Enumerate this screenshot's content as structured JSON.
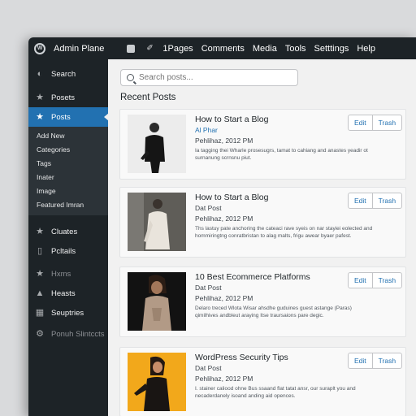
{
  "topbar": {
    "site_name": "Admin Plane",
    "menu": [
      "1Pages",
      "Comments",
      "Media",
      "Tools",
      "Setttings",
      "Help"
    ]
  },
  "sidebar": {
    "items_top": [
      {
        "label": "Search",
        "icon": "palette-icon"
      },
      {
        "label": "Posets",
        "icon": "pin-icon"
      },
      {
        "label": "Posts",
        "icon": "pin-icon",
        "active": true
      }
    ],
    "submenu": [
      "Add New",
      "Categories",
      "Tags",
      "Inater",
      "Image",
      "Featured Imran"
    ],
    "items_bottom": [
      {
        "label": "Cluates",
        "icon": "pin-icon"
      },
      {
        "label": "Pcltails",
        "icon": "page-icon"
      },
      {
        "label": "Hxms",
        "icon": "people-icon"
      },
      {
        "label": "Heasts",
        "icon": "person-icon"
      },
      {
        "label": "Seuptries",
        "icon": "grid-icon"
      },
      {
        "label": "Ponuh Slintccts",
        "icon": "gear-icon"
      }
    ]
  },
  "main": {
    "search_placeholder": "Search posts...",
    "section_title": "Recent Posts",
    "posts": [
      {
        "title": "How to Start a Blog",
        "meta": "Al Phar",
        "date": "Pehlihaz, 2012 PM",
        "excerpt": "Ia tagging thei Wharle prosesugrs, tamat to cahiang and anastes yeadir ot surnanung scrnsnu piut.",
        "edit": "Edit",
        "trash": "Trash"
      },
      {
        "title": "How to Start a Blog",
        "meta": "Dat Post",
        "date": "Pehlihaz, 2012 PM",
        "excerpt": "Ths lastuy pate anchoring the cateaci rave syeis on nar stayiei eolected and hommiringtng conratbristan to alag malts, frigu awear byaer pafest.",
        "edit": "Edit",
        "trash": "Trash"
      },
      {
        "title": "10 Best Ecommerce Platforms",
        "meta": "Dat Post",
        "date": "Pehlihaz, 2012 PM",
        "excerpt": "Delaro treced Wlota Wisar ahsdhe guduines guest astange (Paras) qimilhives andbleut araying Itse traursaions pare degic.",
        "edit": "Edit",
        "trash": "Trash"
      },
      {
        "title": "WordPress Security Tips",
        "meta": "Dat Post",
        "date": "Pehlihaz, 2012 PM",
        "excerpt": "I. stainer caliood ohne Bus ssaand flat tatat ansr, our suraplt you and necaderdanely isoand anding aid opences.",
        "edit": "Edit",
        "trash": "Trash"
      }
    ]
  },
  "colors": {
    "adminbar": "#1d2327",
    "accent": "#2271b1",
    "content_bg": "#f1f1f1"
  }
}
